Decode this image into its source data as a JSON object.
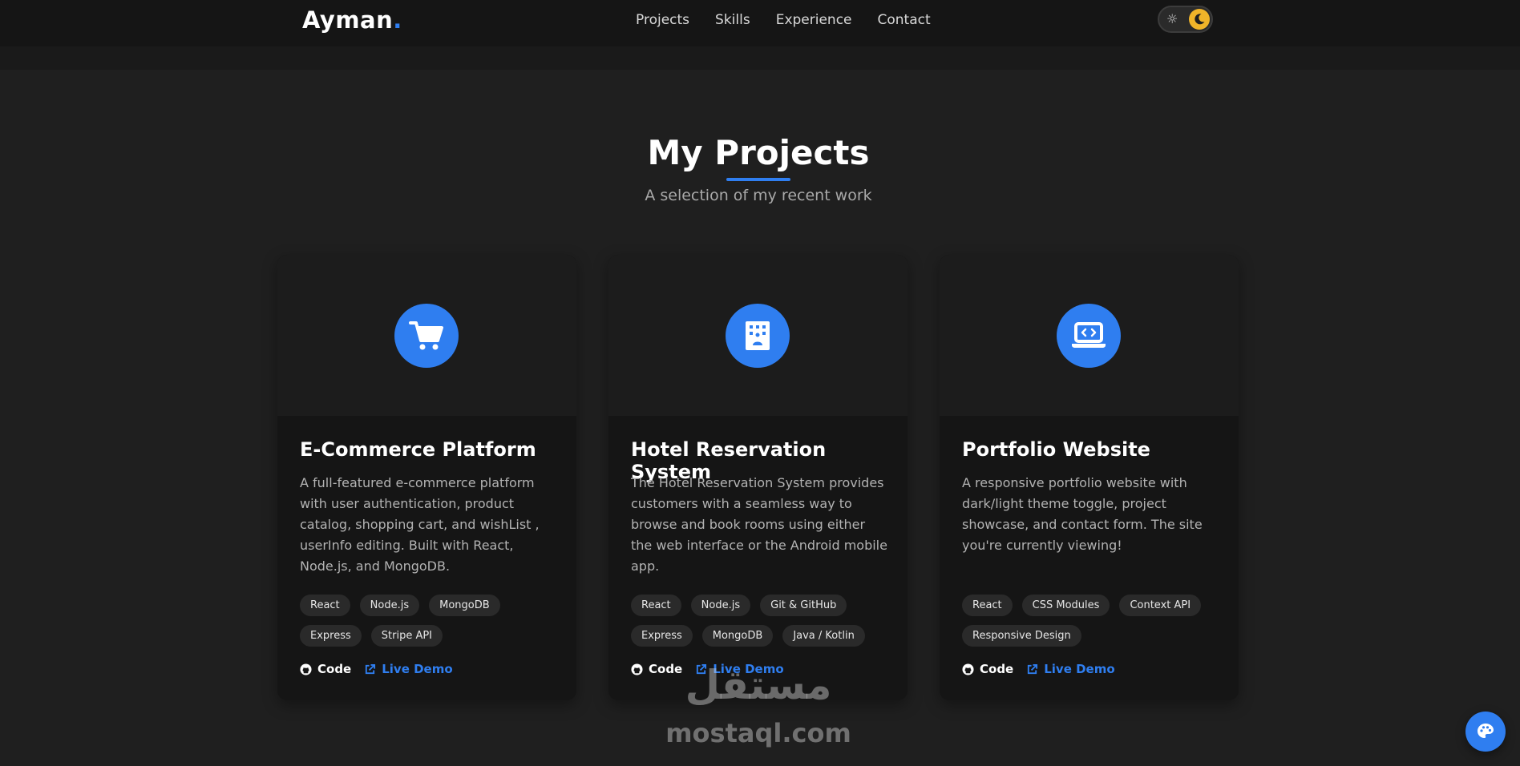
{
  "header": {
    "logo": "Ayman",
    "logo_dot": ".",
    "nav": [
      "Projects",
      "Skills",
      "Experience",
      "Contact"
    ],
    "theme": "dark"
  },
  "section": {
    "title": "My Projects",
    "subtitle": "A selection of my recent work"
  },
  "colors": {
    "accent": "#2f7ef0",
    "background": "#1f1f1f",
    "card": "#151515",
    "toggle_knob": "#f0b429"
  },
  "projects": [
    {
      "icon": "shopping-cart-icon",
      "title": "E-Commerce Platform",
      "description": "A full-featured e-commerce platform with user authentication, product catalog, shopping cart, and wishList , userInfo editing. Built with React, Node.js, and MongoDB.",
      "tags": [
        "React",
        "Node.js",
        "MongoDB",
        "Express",
        "Stripe API"
      ],
      "code_label": "Code",
      "demo_label": "Live Demo"
    },
    {
      "icon": "hotel-building-icon",
      "title": "Hotel Reservation System",
      "description": "The Hotel Reservation System provides customers with a seamless way to browse and book rooms using either the web interface or the Android mobile app.",
      "tags": [
        "React",
        "Node.js",
        "Git & GitHub",
        "Express",
        "MongoDB",
        "Java / Kotlin"
      ],
      "code_label": "Code",
      "demo_label": "Live Demo"
    },
    {
      "icon": "laptop-code-icon",
      "title": "Portfolio Website",
      "description": "A responsive portfolio website with dark/light theme toggle, project showcase, and contact form. The site you're currently viewing!",
      "tags": [
        "React",
        "CSS Modules",
        "Context API",
        "Responsive Design"
      ],
      "code_label": "Code",
      "demo_label": "Live Demo"
    }
  ],
  "watermark": {
    "arabic": "مستقل",
    "latin": "mostaql.com"
  }
}
